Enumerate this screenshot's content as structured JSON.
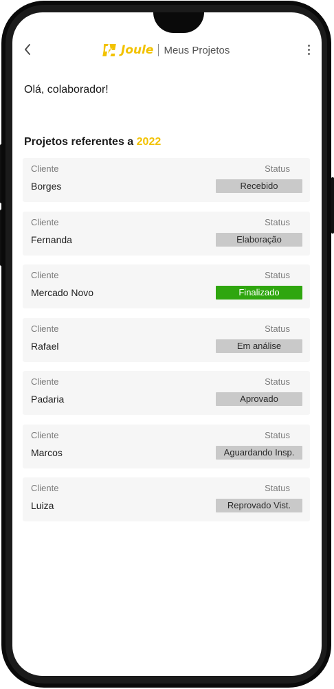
{
  "header": {
    "back_icon": "chevron-left-icon",
    "brand_name": "Joule",
    "title": "Meus Projetos",
    "more_icon": "more-vertical-icon",
    "brand_color": "#f2c200"
  },
  "greeting": "Olá, colaborador!",
  "section": {
    "title_prefix": "Projetos referentes a",
    "year": "2022"
  },
  "projects": [
    {
      "client_label": "Cliente",
      "client": "Borges",
      "status_label": "Status",
      "status": "Recebido",
      "status_color": "#c9c9c9"
    },
    {
      "client_label": "Cliente",
      "client": "Fernanda",
      "status_label": "Status",
      "status": "Elaboração",
      "status_color": "#c9c9c9"
    },
    {
      "client_label": "Cliente",
      "client": "Mercado Novo",
      "status_label": "Status",
      "status": "Finalizado",
      "status_color": "#2fa60f"
    },
    {
      "client_label": "Cliente",
      "client": "Rafael",
      "status_label": "Status",
      "status": "Em análise",
      "status_color": "#c9c9c9"
    },
    {
      "client_label": "Cliente",
      "client": "Padaria",
      "status_label": "Status",
      "status": "Aprovado",
      "status_color": "#c9c9c9"
    },
    {
      "client_label": "Cliente",
      "client": "Marcos",
      "status_label": "Status",
      "status": "Aguardando Insp.",
      "status_color": "#c9c9c9"
    },
    {
      "client_label": "Cliente",
      "client": "Luiza",
      "status_label": "Status",
      "status": "Reprovado Vist.",
      "status_color": "#c9c9c9"
    }
  ]
}
